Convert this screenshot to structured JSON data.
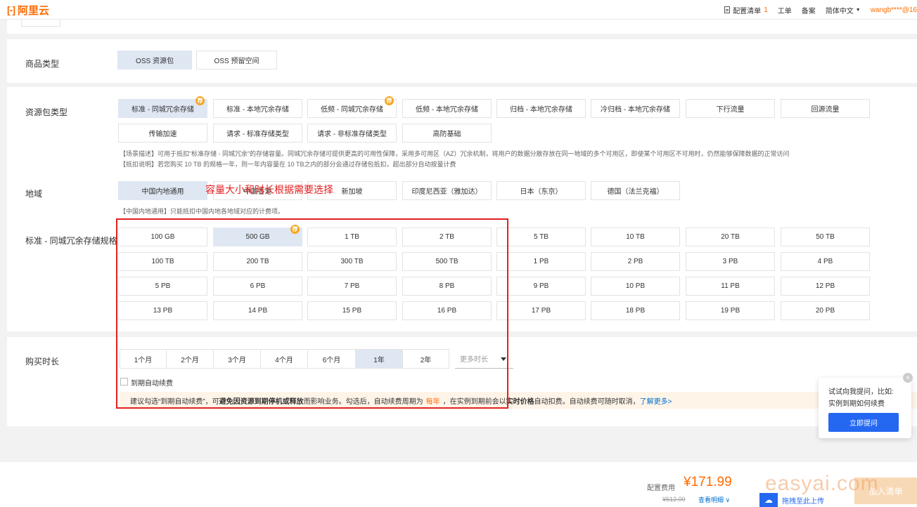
{
  "header": {
    "logo_mark": "[-]",
    "logo_text": "阿里云",
    "config_list": "配置清单",
    "config_count": "1",
    "ticket": "工单",
    "beian": "备案",
    "language": "简体中文",
    "user": "wangb****@16"
  },
  "product_type": {
    "label": "商品类型",
    "options": [
      "OSS 资源包",
      "OSS 预留空间"
    ]
  },
  "package_type": {
    "label": "资源包类型",
    "options": [
      "标准 - 同城冗余存储",
      "标准 - 本地冗余存储",
      "低频 - 同城冗余存储",
      "低频 - 本地冗余存储",
      "归档 - 本地冗余存储",
      "冷归档 - 本地冗余存储",
      "下行流量",
      "回源流量",
      "传输加速",
      "请求 - 标准存储类型",
      "请求 - 非标准存储类型",
      "高防基础"
    ],
    "desc_line1": "【场景描述】可用于抵扣“标准存储 - 同城冗余”的存储容量。同城冗余存储可提供更高的可用性保障，采用多可用区（AZ）冗余机制，将用户的数据分散存放在同一地域的多个可用区，即使某个可用区不可用时，仍然能够保障数据的正常访问",
    "desc_line2": "【抵扣说明】若您购买 10 TB 的规格一年，则一年内容量在 10 TB之内的部分会通过存储包抵扣，超出部分自动按量计费"
  },
  "region": {
    "label": "地域",
    "options": [
      "中国内地通用",
      "中国香港",
      "新加坡",
      "印度尼西亚（雅加达）",
      "日本（东京）",
      "德国（法兰克福）"
    ],
    "desc": "【中国内地通用】只能抵扣中国内地各地域对应的计费项。"
  },
  "spec": {
    "label": "标准 - 同城冗余存储规格",
    "options": [
      "100 GB",
      "500 GB",
      "1 TB",
      "2 TB",
      "5 TB",
      "10 TB",
      "20 TB",
      "50 TB",
      "100 TB",
      "200 TB",
      "300 TB",
      "500 TB",
      "1 PB",
      "2 PB",
      "3 PB",
      "4 PB",
      "5 PB",
      "6 PB",
      "7 PB",
      "8 PB",
      "9 PB",
      "10 PB",
      "11 PB",
      "12 PB",
      "13 PB",
      "14 PB",
      "15 PB",
      "16 PB",
      "17 PB",
      "18 PB",
      "19 PB",
      "20 PB"
    ]
  },
  "duration": {
    "label": "购买时长",
    "options": [
      "1个月",
      "2个月",
      "3个月",
      "4个月",
      "6个月",
      "1年",
      "2年"
    ],
    "more": "更多时长",
    "auto_renew": "到期自动续费",
    "notice_a": "建议勾选“到期自动续费”，可",
    "notice_b": "避免因资源到期停机或释放",
    "notice_c": "而影响业务。勾选后，自动续费周期为",
    "notice_period": "每年",
    "notice_d": "，在实例到期前会以",
    "notice_e": "实时价格",
    "notice_f": "自动扣费。自动续费可随时取消，",
    "notice_link": "了解更多>"
  },
  "annotation": "容量大小和时长根据需要选择",
  "help": {
    "line1": "试试向我提问，比如:",
    "line2": "实例到期如何续费",
    "button": "立即提问",
    "close": "×"
  },
  "footer": {
    "price_label": "配置费用",
    "price": "¥171.99",
    "old_price": "¥612.00",
    "detail_link": "查看明细",
    "add_button": "加入清单",
    "watermark": "easyai.com",
    "upload": "拖拽至此上传"
  },
  "colors": {
    "accent": "#ff6a00",
    "selected_bg": "#dfe7f3",
    "primary": "#2468f2",
    "annotation": "#e32020"
  }
}
